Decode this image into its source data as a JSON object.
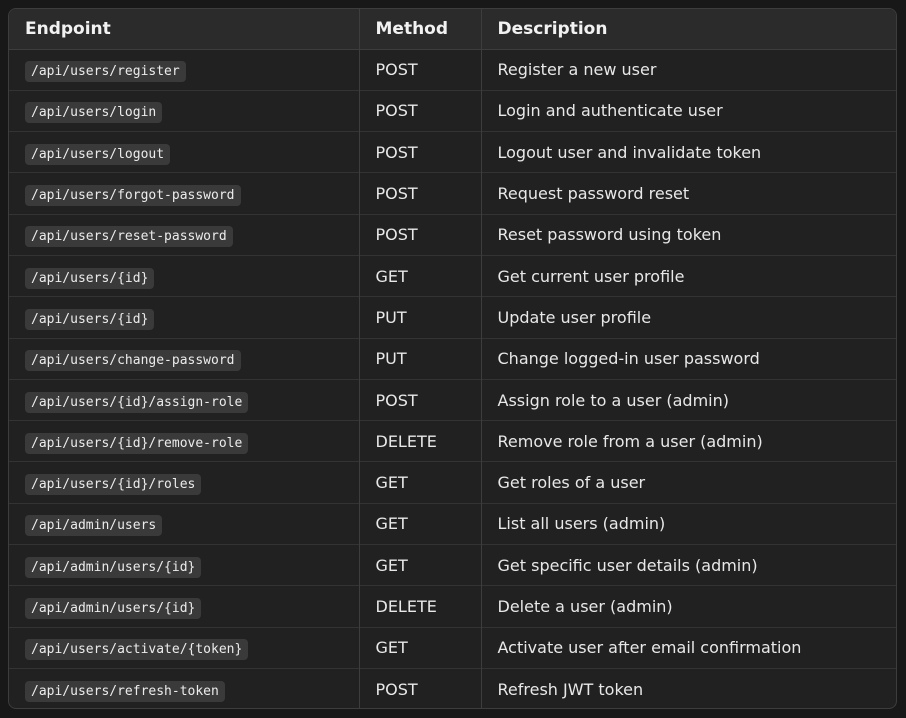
{
  "table": {
    "headers": {
      "endpoint": "Endpoint",
      "method": "Method",
      "description": "Description"
    },
    "rows": [
      {
        "endpoint": "/api/users/register",
        "method": "POST",
        "description": "Register a new user"
      },
      {
        "endpoint": "/api/users/login",
        "method": "POST",
        "description": "Login and authenticate user"
      },
      {
        "endpoint": "/api/users/logout",
        "method": "POST",
        "description": "Logout user and invalidate token"
      },
      {
        "endpoint": "/api/users/forgot-password",
        "method": "POST",
        "description": "Request password reset"
      },
      {
        "endpoint": "/api/users/reset-password",
        "method": "POST",
        "description": "Reset password using token"
      },
      {
        "endpoint": "/api/users/{id}",
        "method": "GET",
        "description": "Get current user profile"
      },
      {
        "endpoint": "/api/users/{id}",
        "method": "PUT",
        "description": "Update user profile"
      },
      {
        "endpoint": "/api/users/change-password",
        "method": "PUT",
        "description": "Change logged-in user password"
      },
      {
        "endpoint": "/api/users/{id}/assign-role",
        "method": "POST",
        "description": "Assign role to a user (admin)"
      },
      {
        "endpoint": "/api/users/{id}/remove-role",
        "method": "DELETE",
        "description": "Remove role from a user (admin)"
      },
      {
        "endpoint": "/api/users/{id}/roles",
        "method": "GET",
        "description": "Get roles of a user"
      },
      {
        "endpoint": "/api/admin/users",
        "method": "GET",
        "description": "List all users (admin)"
      },
      {
        "endpoint": "/api/admin/users/{id}",
        "method": "GET",
        "description": "Get specific user details (admin)"
      },
      {
        "endpoint": "/api/admin/users/{id}",
        "method": "DELETE",
        "description": "Delete a user (admin)"
      },
      {
        "endpoint": "/api/users/activate/{token}",
        "method": "GET",
        "description": "Activate user after email confirmation"
      },
      {
        "endpoint": "/api/users/refresh-token",
        "method": "POST",
        "description": "Refresh JWT token"
      }
    ]
  }
}
